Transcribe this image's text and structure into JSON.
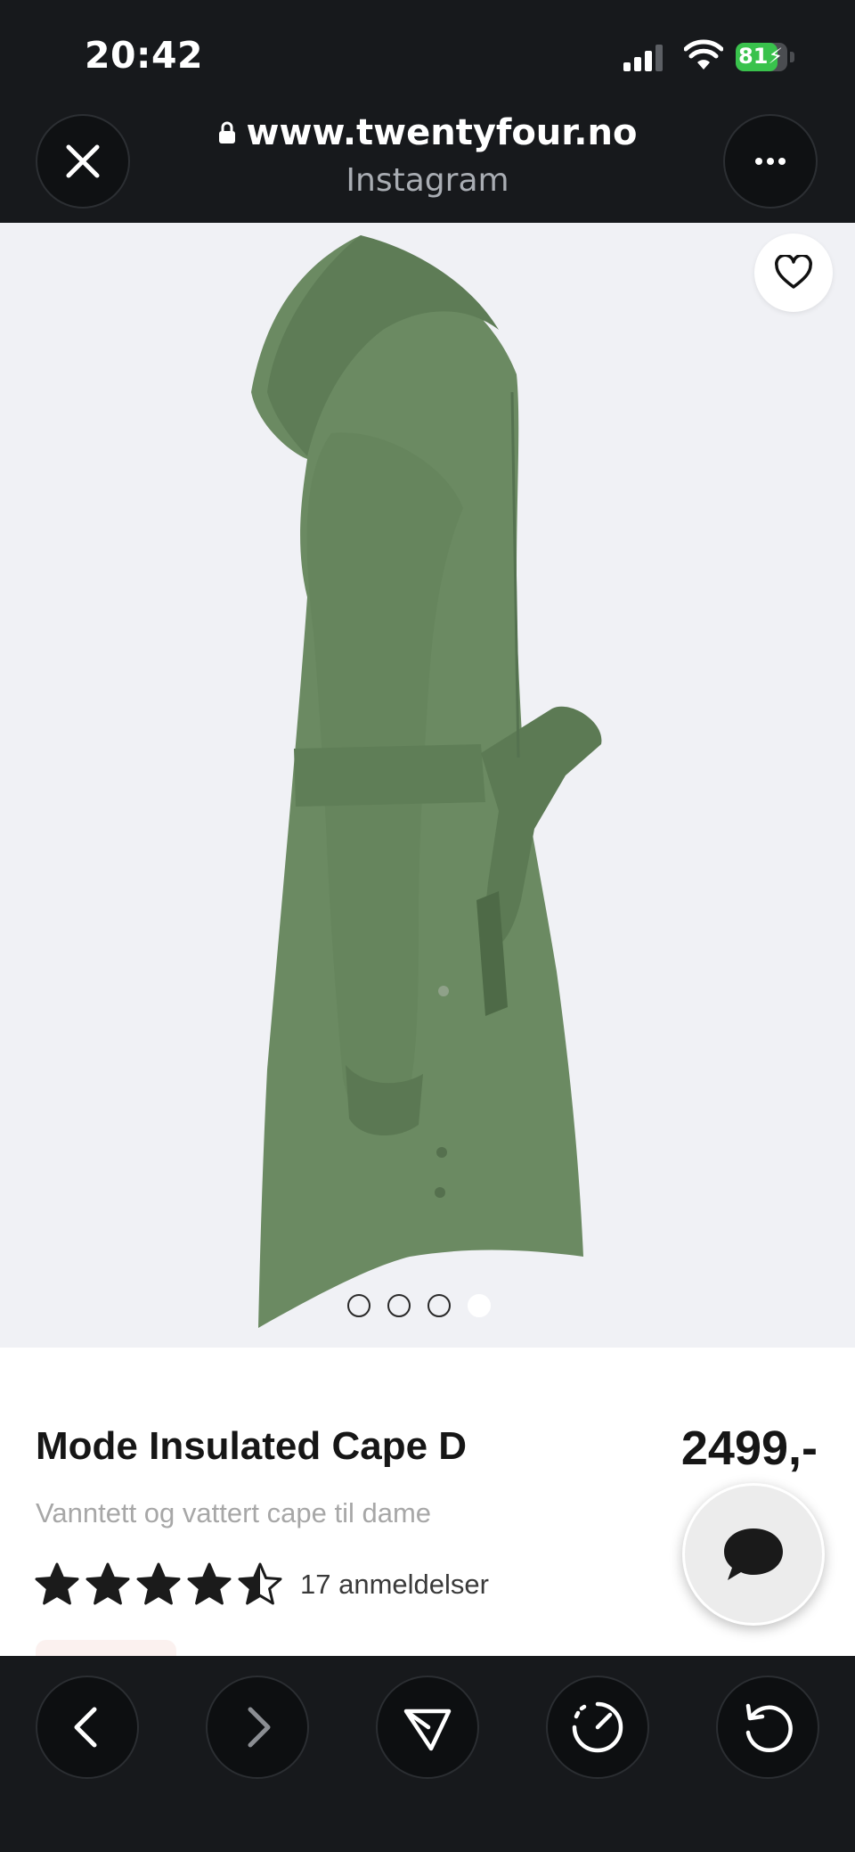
{
  "status": {
    "time": "20:42",
    "battery_percent": "81",
    "battery_level": 0.81,
    "charging": true
  },
  "browser": {
    "url": "www.twentyfour.no",
    "source": "Instagram",
    "close_icon": "close-icon",
    "more_icon": "more-icon"
  },
  "gallery": {
    "image_count": 4,
    "active_index": 3,
    "favorite_icon": "heart-icon",
    "image_description": "green hooded insulated coat with belt, side view"
  },
  "product": {
    "name": "Mode Insulated Cape D",
    "price": "2499,-",
    "description": "Vanntett og vattert cape til dame",
    "rating": 4.5,
    "rating_max": 5,
    "reviews_label": "17 anmeldelser"
  },
  "colors": {
    "dark_bg": "#17191c",
    "image_bg": "#f0f1f5",
    "coat_green": "#6b8a62",
    "battery_green": "#39c24c"
  },
  "toolbar": {
    "items": [
      "back-icon",
      "forward-icon",
      "share-icon",
      "dashboard-icon",
      "refresh-icon"
    ]
  }
}
